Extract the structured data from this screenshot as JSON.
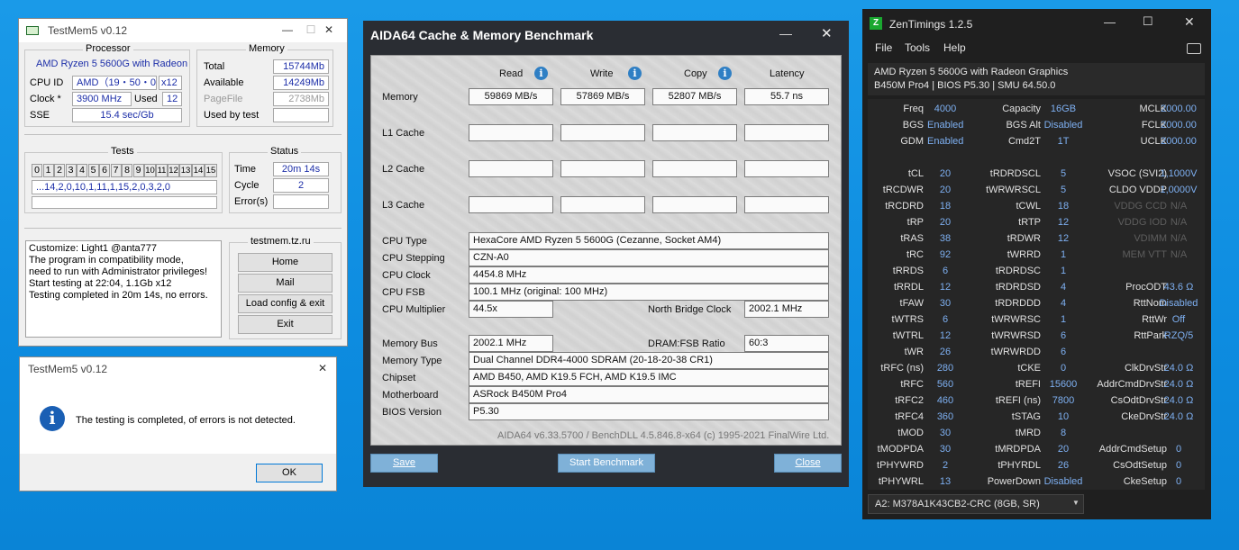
{
  "testmem": {
    "title": "TestMem5 v0.12",
    "processor_group": "Processor",
    "cpu_name": "AMD Ryzen 5 5600G with Radeon",
    "cpu_id_label": "CPU ID",
    "cpu_id_value": "AMD（19・50・0）",
    "cpu_threads": "x12",
    "clock_label": "Clock *",
    "clock_value": "3900 MHz",
    "used_label": "Used",
    "used_value": "12",
    "sse_label": "SSE",
    "sse_value": "15.4 sec/Gb",
    "memory_group": "Memory",
    "total_label": "Total",
    "total_value": "15744Mb",
    "available_label": "Available",
    "available_value": "14249Mb",
    "pagefile_label": "PageFile",
    "pagefile_value": "2738Mb",
    "usedbytest_label": "Used by test",
    "usedbytest_value": "",
    "tests_group": "Tests",
    "tests_numbers": [
      "0",
      "1",
      "2",
      "3",
      "4",
      "5",
      "6",
      "7",
      "8",
      "9",
      "10",
      "11",
      "12",
      "13",
      "14",
      "15"
    ],
    "tests_sequence": "...14,2,0,10,1,11,1,15,2,0,3,2,0",
    "status_group": "Status",
    "time_label": "Time",
    "time_value": "20m 14s",
    "cycle_label": "Cycle",
    "cycle_value": "2",
    "errors_label": "Error(s)",
    "errors_value": "",
    "log_lines": [
      "Customize: Light1 @anta777",
      "The program in compatibility mode,",
      "need to run with Administrator privileges!",
      "Start testing at 22:04, 1.1Gb x12",
      "Testing completed in 20m 14s, no errors."
    ],
    "site": "testmem.tz.ru",
    "buttons": {
      "home": "Home",
      "mail": "Mail",
      "load": "Load config & exit",
      "exit": "Exit"
    }
  },
  "dialog": {
    "title": "TestMem5 v0.12",
    "message": "The testing is completed, of errors is not detected.",
    "ok": "OK"
  },
  "aida": {
    "title": "AIDA64 Cache & Memory Benchmark",
    "cols": {
      "read": "Read",
      "write": "Write",
      "copy": "Copy",
      "latency": "Latency"
    },
    "rows": [
      {
        "label": "Memory",
        "read": "59869 MB/s",
        "write": "57869 MB/s",
        "copy": "52807 MB/s",
        "latency": "55.7 ns"
      },
      {
        "label": "L1 Cache",
        "read": "",
        "write": "",
        "copy": "",
        "latency": ""
      },
      {
        "label": "L2 Cache",
        "read": "",
        "write": "",
        "copy": "",
        "latency": ""
      },
      {
        "label": "L3 Cache",
        "read": "",
        "write": "",
        "copy": "",
        "latency": ""
      }
    ],
    "info": {
      "cpu_type_label": "CPU Type",
      "cpu_type": "HexaCore AMD Ryzen 5 5600G  (Cezanne, Socket AM4)",
      "cpu_stepping_label": "CPU Stepping",
      "cpu_stepping": "CZN-A0",
      "cpu_clock_label": "CPU Clock",
      "cpu_clock": "4454.8 MHz",
      "cpu_fsb_label": "CPU FSB",
      "cpu_fsb": "100.1 MHz  (original: 100 MHz)",
      "cpu_mult_label": "CPU Multiplier",
      "cpu_mult": "44.5x",
      "nb_clock_label": "North Bridge Clock",
      "nb_clock": "2002.1 MHz",
      "mem_bus_label": "Memory Bus",
      "mem_bus": "2002.1 MHz",
      "dram_ratio_label": "DRAM:FSB Ratio",
      "dram_ratio": "60:3",
      "mem_type_label": "Memory Type",
      "mem_type": "Dual Channel DDR4-4000 SDRAM  (20-18-20-38 CR1)",
      "chipset_label": "Chipset",
      "chipset": "AMD B450, AMD K19.5 FCH, AMD K19.5 IMC",
      "mobo_label": "Motherboard",
      "mobo": "ASRock B450M Pro4",
      "bios_label": "BIOS Version",
      "bios": "P5.30"
    },
    "footer": "AIDA64 v6.33.5700 / BenchDLL 4.5.846.8-x64  (c) 1995-2021 FinalWire Ltd.",
    "buttons": {
      "save": "Save",
      "start": "Start Benchmark",
      "close": "Close"
    }
  },
  "zen": {
    "title": "ZenTimings 1.2.5",
    "menu": [
      "File",
      "Tools",
      "Help"
    ],
    "cpu": "AMD Ryzen 5 5600G with Radeon Graphics",
    "board": "B450M Pro4 | BIOS P5.30 | SMU 64.50.0",
    "rows": [
      [
        [
          "Freq",
          "4000"
        ],
        [
          "Capacity",
          "16GB"
        ],
        [
          "MCLK",
          "2000.00"
        ]
      ],
      [
        [
          "BGS",
          "Enabled"
        ],
        [
          "BGS Alt",
          "Disabled"
        ],
        [
          "FCLK",
          "2000.00"
        ]
      ],
      [
        [
          "GDM",
          "Enabled"
        ],
        [
          "Cmd2T",
          "1T"
        ],
        [
          "UCLK",
          "2000.00"
        ]
      ],
      [
        [
          "",
          ""
        ],
        [
          "",
          ""
        ],
        [
          "",
          ""
        ]
      ],
      [
        [
          "tCL",
          "20"
        ],
        [
          "tRDRDSCL",
          "5"
        ],
        [
          "VSOC (SVI2)",
          "1,1000V"
        ]
      ],
      [
        [
          "tRCDWR",
          "20"
        ],
        [
          "tWRWRSCL",
          "5"
        ],
        [
          "CLDO VDDP",
          "1,0000V"
        ]
      ],
      [
        [
          "tRCDRD",
          "18"
        ],
        [
          "tCWL",
          "18"
        ],
        [
          "VDDG CCD",
          "N/A"
        ]
      ],
      [
        [
          "tRP",
          "20"
        ],
        [
          "tRTP",
          "12"
        ],
        [
          "VDDG IOD",
          "N/A"
        ]
      ],
      [
        [
          "tRAS",
          "38"
        ],
        [
          "tRDWR",
          "12"
        ],
        [
          "VDIMM",
          "N/A"
        ]
      ],
      [
        [
          "tRC",
          "92"
        ],
        [
          "tWRRD",
          "1"
        ],
        [
          "MEM VTT",
          "N/A"
        ]
      ],
      [
        [
          "tRRDS",
          "6"
        ],
        [
          "tRDRDSC",
          "1"
        ],
        [
          "",
          ""
        ]
      ],
      [
        [
          "tRRDL",
          "12"
        ],
        [
          "tRDRDSD",
          "4"
        ],
        [
          "ProcODT",
          "43.6 Ω"
        ]
      ],
      [
        [
          "tFAW",
          "30"
        ],
        [
          "tRDRDDD",
          "4"
        ],
        [
          "RttNom",
          "Disabled"
        ]
      ],
      [
        [
          "tWTRS",
          "6"
        ],
        [
          "tWRWRSC",
          "1"
        ],
        [
          "RttWr",
          "Off"
        ]
      ],
      [
        [
          "tWTRL",
          "12"
        ],
        [
          "tWRWRSD",
          "6"
        ],
        [
          "RttPark",
          "RZQ/5"
        ]
      ],
      [
        [
          "tWR",
          "26"
        ],
        [
          "tWRWRDD",
          "6"
        ],
        [
          "",
          ""
        ]
      ],
      [
        [
          "tRFC (ns)",
          "280"
        ],
        [
          "tCKE",
          "0"
        ],
        [
          "ClkDrvStr",
          "24.0 Ω"
        ]
      ],
      [
        [
          "tRFC",
          "560"
        ],
        [
          "tREFI",
          "15600"
        ],
        [
          "AddrCmdDrvStr",
          "24.0 Ω"
        ]
      ],
      [
        [
          "tRFC2",
          "460"
        ],
        [
          "tREFI (ns)",
          "7800"
        ],
        [
          "CsOdtDrvStr",
          "24.0 Ω"
        ]
      ],
      [
        [
          "tRFC4",
          "360"
        ],
        [
          "tSTAG",
          "10"
        ],
        [
          "CkeDrvStr",
          "24.0 Ω"
        ]
      ],
      [
        [
          "tMOD",
          "30"
        ],
        [
          "tMRD",
          "8"
        ],
        [
          "",
          ""
        ]
      ],
      [
        [
          "tMODPDA",
          "30"
        ],
        [
          "tMRDPDA",
          "20"
        ],
        [
          "AddrCmdSetup",
          "0"
        ]
      ],
      [
        [
          "tPHYWRD",
          "2"
        ],
        [
          "tPHYRDL",
          "26"
        ],
        [
          "CsOdtSetup",
          "0"
        ]
      ],
      [
        [
          "tPHYWRL",
          "13"
        ],
        [
          "PowerDown",
          "Disabled"
        ],
        [
          "CkeSetup",
          "0"
        ]
      ]
    ],
    "disabled_keys": [
      "VDDG CCD",
      "VDDG IOD",
      "VDIMM",
      "MEM VTT"
    ],
    "module": "A2: M378A1K43CB2-CRC (8GB, SR)",
    "colors": {
      "value": "#7eb0f2",
      "bg": "#1f1f1f",
      "accent": "#1aa830"
    }
  }
}
